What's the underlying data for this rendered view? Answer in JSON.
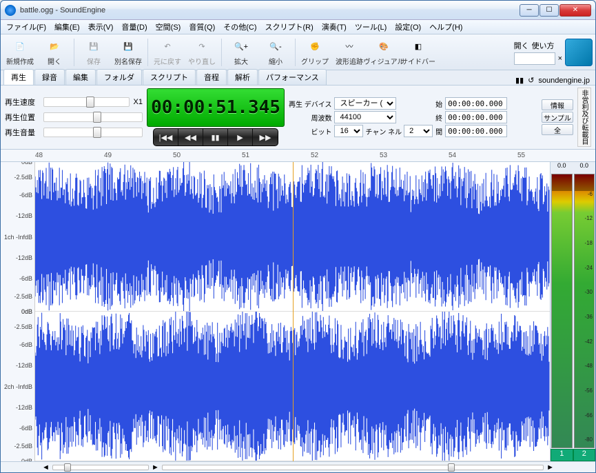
{
  "window": {
    "title": "battle.ogg - SoundEngine"
  },
  "menu": [
    "ファイル(F)",
    "編集(E)",
    "表示(V)",
    "音量(D)",
    "空間(S)",
    "音質(Q)",
    "その他(C)",
    "スクリプト(R)",
    "演奏(T)",
    "ツール(L)",
    "設定(O)",
    "ヘルプ(H)"
  ],
  "toolbar": [
    {
      "name": "new",
      "label": "新規作成"
    },
    {
      "name": "open",
      "label": "開く"
    },
    {
      "name": "save",
      "label": "保存",
      "dim": true
    },
    {
      "name": "saveas",
      "label": "別名保存"
    },
    {
      "name": "undo",
      "label": "元に戻す",
      "dim": true
    },
    {
      "name": "redo",
      "label": "やり直し",
      "dim": true
    },
    {
      "name": "zoomin",
      "label": "拡大"
    },
    {
      "name": "zoomout",
      "label": "縮小"
    },
    {
      "name": "grip",
      "label": "グリップ"
    },
    {
      "name": "waveform",
      "label": "波形追跡"
    },
    {
      "name": "visual",
      "label": "ヴィジュアル"
    },
    {
      "name": "sidebar",
      "label": "サイドバー"
    }
  ],
  "search": {
    "open": "開く",
    "howto": "使い方",
    "close": "×"
  },
  "tabs": [
    "再生",
    "録音",
    "編集",
    "フォルダ",
    "スクリプト",
    "音程",
    "解析",
    "パフォーマンス"
  ],
  "activeTab": 0,
  "brand_url": "soundengine.jp",
  "sliders": {
    "speed": {
      "label": "再生速度",
      "value": "X1"
    },
    "position": {
      "label": "再生位置"
    },
    "volume": {
      "label": "再生音量"
    }
  },
  "timer": "00:00:51.345",
  "params": {
    "device_label": "再生\nデバイス",
    "device_value": "スピーカー (",
    "freq_label": "周波数",
    "freq_value": "44100",
    "bit_label": "ビット",
    "bit_value": "16",
    "chan_label": "チャン\nネル",
    "chan_value": "2",
    "start_label": "始",
    "start_value": "00:00:00.000",
    "end_label": "終",
    "end_value": "00:00:00.000",
    "gap_label": "間",
    "gap_value": "00:00:00.000",
    "info": "情報",
    "sample": "サンプル",
    "all": "全"
  },
  "side_text": "非営利及び転載目",
  "ruler": {
    "start": 48,
    "end": 55,
    "labels": [
      "48",
      "49",
      "50",
      "51",
      "52",
      "53",
      "54",
      "55"
    ]
  },
  "db_labels": [
    "0dB",
    "-2.5dB",
    "-6dB",
    "-12dB",
    "-InfdB",
    "-12dB",
    "-6dB",
    "-2.5dB",
    "0dB"
  ],
  "channels": [
    "1ch",
    "2ch"
  ],
  "meter": {
    "peak1": "0.0",
    "peak2": "0.0",
    "ticks": [
      "-6",
      "-12",
      "-18",
      "-24",
      "-30",
      "-36",
      "-42",
      "-48",
      "-56",
      "-66",
      "-80"
    ],
    "foot1": "1",
    "foot2": "2"
  }
}
